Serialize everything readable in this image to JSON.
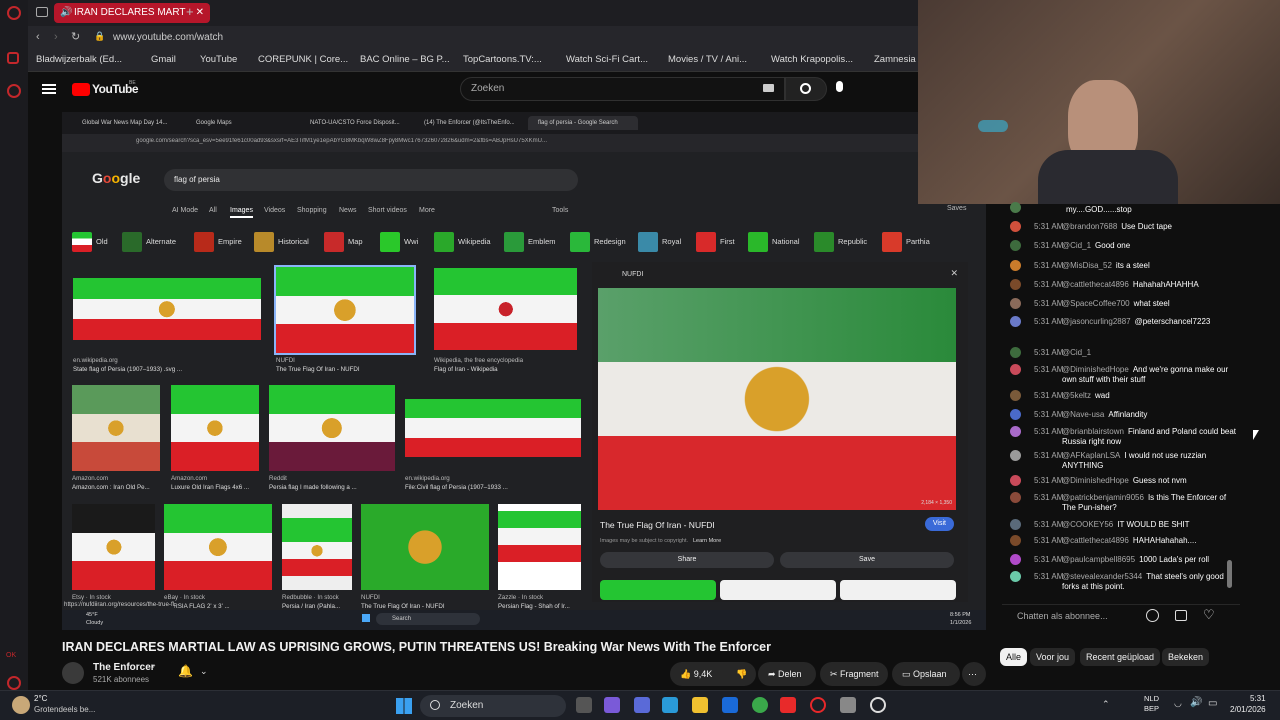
{
  "browser": {
    "active_tab": "IRAN DECLARES MART",
    "url": "www.youtube.com/watch",
    "bookmarks": [
      "Bladwijzerbalk (Ed...",
      "Gmail",
      "YouTube",
      "COREPUNK | Core...",
      "BAC Online – BG P...",
      "TopCartoons.TV:...",
      "Watch Sci-Fi Cart...",
      "Movies / TV / Ani...",
      "Watch Krapopolis...",
      "Zamnesia |"
    ]
  },
  "youtube": {
    "logo": "YouTube",
    "logo_region": "BE",
    "search_placeholder": "Zoeken"
  },
  "video": {
    "inner_tabs": [
      "Global War News Map Day 14...",
      "Google Maps",
      "NATO-UA/CSTO Force Disposit...",
      "(14) The Enforcer (@ItsTheEnfo...",
      "flag of persia - Google Search"
    ],
    "inner_url": "google.com/search?sca_esv=5ee91fe61c00ad93&sxsrf=AE3TifM1ye1epAbYG8MKbqW8wZ8Fpy8Mwc1767326072826&udm=2&fbs=ABJpHsU75XKmU...",
    "google_query": "flag of persia",
    "google_tabs": [
      "AI Mode",
      "All",
      "Images",
      "Videos",
      "Shopping",
      "News",
      "Short videos",
      "More",
      "Tools",
      "Saves"
    ],
    "chips": [
      "Old",
      "Alternate",
      "Empire",
      "Historical",
      "Map",
      "Wwi",
      "Wikipedia",
      "Emblem",
      "Redesign",
      "Royal",
      "First",
      "National",
      "Republic",
      "Parthia"
    ],
    "captions": [
      {
        "src": "en.wikipedia.org",
        "title": "State flag of Persia (1907–1933) .svg ..."
      },
      {
        "src": "NUFDI",
        "title": "The True Flag Of Iran - NUFDI"
      },
      {
        "src": "Wikipedia, the free encyclopedia",
        "title": "Flag of Iran - Wikipedia"
      },
      {
        "src": "Amazon.com",
        "title": "Amazon.com : Iran Old Pe..."
      },
      {
        "src": "Amazon.com",
        "title": "Luxure Old Iran Flags 4x6 ..."
      },
      {
        "src": "Reddit",
        "title": "Persia flag I made following a ..."
      },
      {
        "src": "en.wikipedia.org",
        "title": "File:Civil flag of Persia (1907–1933 ..."
      },
      {
        "src": "Etsy · In stock",
        "title": ""
      },
      {
        "src": "eBay · In stock",
        "title": "...ERSIA FLAG 2' x 3' ..."
      },
      {
        "src": "Redbubble · In stock",
        "title": "Persia / Iran (Pahla..."
      },
      {
        "src": "NUFDI",
        "title": "The True Flag Of Iran - NUFDI"
      },
      {
        "src": "Zazzle · In stock",
        "title": "Persian Flag - Shah of Ir..."
      }
    ],
    "preview": {
      "source": "NUFDI",
      "dims": "2,184 × 1,350",
      "title": "The True Flag Of Iran - NUFDI",
      "visit": "Visit",
      "copyright": "Images may be subject to copyright.",
      "learn_more": "Learn More",
      "share": "Share",
      "save": "Save"
    },
    "status_url": "https://nufdiiran.org/resources/the-true-flag-of-iran/",
    "inner_taskbar": {
      "temp": "45°F",
      "weather": "Cloudy",
      "search": "Search",
      "time": "8:56 PM",
      "date": "1/1/2026"
    }
  },
  "chat": {
    "messages": [
      {
        "time": "",
        "author": "",
        "text": "my....GOD......stop",
        "color": "#4a7a4a"
      },
      {
        "time": "5:31 AM",
        "author": "@brandon7688",
        "text": "Use Duct tape",
        "color": "#d0503c"
      },
      {
        "time": "5:31 AM",
        "author": "@Cid_1",
        "text": "Good one",
        "color": "#3d6b3d"
      },
      {
        "time": "5:31 AM",
        "author": "@MisDisa_52",
        "text": "its a steel",
        "color": "#c97b2b"
      },
      {
        "time": "5:31 AM",
        "author": "@cattlethecat4896",
        "text": "HahahahAHAHHA",
        "color": "#7a4a2a"
      },
      {
        "time": "5:31 AM",
        "author": "@SpaceCoffee700",
        "text": "what steel",
        "color": "#8a6a5a"
      },
      {
        "time": "5:31 AM",
        "author": "@jasoncurling2887",
        "text": "@peterschancel7223",
        "color": "#6a7ac9"
      },
      {
        "time": "5:31 AM",
        "author": "@Cid_1",
        "text": "",
        "color": "#3d6b3d"
      },
      {
        "time": "5:31 AM",
        "author": "@DiminishedHope",
        "text": "And we're gonna make our own stuff with their stuff",
        "color": "#c94a5a"
      },
      {
        "time": "5:31 AM",
        "author": "@5keltz",
        "text": "wad",
        "color": "#7a5a3a"
      },
      {
        "time": "5:31 AM",
        "author": "@Nave-usa",
        "text": "Affinlandity",
        "color": "#4a6ac9"
      },
      {
        "time": "5:31 AM",
        "author": "@brianblairstown",
        "text": "Finland and Poland could beat Russia right now",
        "color": "#a96ac9"
      },
      {
        "time": "5:31 AM",
        "author": "@AFKaplanLSA",
        "text": "I would not use ruzzian ANYTHING",
        "color": "#9a9a9a"
      },
      {
        "time": "5:31 AM",
        "author": "@DiminishedHope",
        "text": "Guess not nvm",
        "color": "#c94a5a"
      },
      {
        "time": "5:31 AM",
        "author": "@patrickbenjamin9056",
        "text": "Is this The Enforcer of The Pun-isher?",
        "color": "#8a4a3a"
      },
      {
        "time": "5:31 AM",
        "author": "@COOKEY56",
        "text": "IT WOULD BE SHIT",
        "color": "#5a6a7a"
      },
      {
        "time": "5:31 AM",
        "author": "@cattlethecat4896",
        "text": "HAHAHahahah....",
        "color": "#7a4a2a"
      },
      {
        "time": "5:31 AM",
        "author": "@paulcampbell8695",
        "text": "1000 Lada's per roll",
        "color": "#b04ac9"
      },
      {
        "time": "5:31 AM",
        "author": "@stevealexander5344",
        "text": "That steel's only good forks at this point.",
        "color": "#6ac9a9"
      }
    ],
    "input_placeholder": "Chatten als abonnee..."
  },
  "video_info": {
    "title": "IRAN DECLARES MARTIAL LAW AS UPRISING GROWS, PUTIN THREATENS US! Breaking War News With The Enforcer",
    "channel": "The Enforcer",
    "subscribers": "521K abonnees",
    "likes": "9,4K",
    "share": "Delen",
    "clip": "Fragment",
    "save": "Opslaan",
    "filter_tabs": [
      "Alle",
      "Voor jou",
      "Recent geüpload",
      "Bekeken"
    ]
  },
  "taskbar": {
    "temp": "2°C",
    "weather": "Grotendeels be...",
    "search": "Zoeken",
    "lang": "NLD",
    "layout": "BEP",
    "time": "5:31",
    "date": "2/01/2026"
  }
}
